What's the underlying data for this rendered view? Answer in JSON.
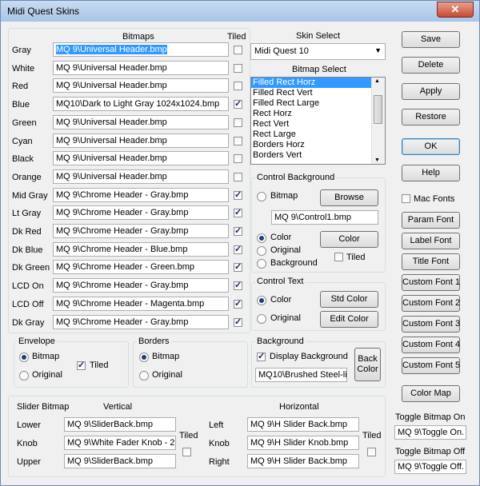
{
  "window": {
    "title": "Midi Quest Skins",
    "close_glyph": "✕"
  },
  "bitmaps": {
    "header": "Bitmaps",
    "tiled_header": "Tiled",
    "rows": [
      {
        "label": "Gray",
        "value": "MQ 9\\Universal Header.bmp",
        "tiled": false,
        "selected": true
      },
      {
        "label": "White",
        "value": "MQ 9\\Universal Header.bmp",
        "tiled": false
      },
      {
        "label": "Red",
        "value": "MQ 9\\Universal Header.bmp",
        "tiled": false
      },
      {
        "label": "Blue",
        "value": "MQ10\\Dark to Light Gray 1024x1024.bmp",
        "tiled": true
      },
      {
        "label": "Green",
        "value": "MQ 9\\Universal Header.bmp",
        "tiled": false
      },
      {
        "label": "Cyan",
        "value": "MQ 9\\Universal Header.bmp",
        "tiled": false
      },
      {
        "label": "Black",
        "value": "MQ 9\\Universal Header.bmp",
        "tiled": false
      },
      {
        "label": "Orange",
        "value": "MQ 9\\Universal Header.bmp",
        "tiled": false
      },
      {
        "label": "Mid Gray",
        "value": "MQ 9\\Chrome Header - Gray.bmp",
        "tiled": true
      },
      {
        "label": "Lt Gray",
        "value": "MQ 9\\Chrome Header - Gray.bmp",
        "tiled": true
      },
      {
        "label": "Dk Red",
        "value": "MQ 9\\Chrome Header - Gray.bmp",
        "tiled": true
      },
      {
        "label": "Dk Blue",
        "value": "MQ 9\\Chrome Header - Blue.bmp",
        "tiled": true
      },
      {
        "label": "Dk Green",
        "value": "MQ 9\\Chrome Header - Green.bmp",
        "tiled": true
      },
      {
        "label": "LCD On",
        "value": "MQ 9\\Chrome Header - Gray.bmp",
        "tiled": true
      },
      {
        "label": "LCD Off",
        "value": "MQ 9\\Chrome Header - Magenta.bmp",
        "tiled": true
      },
      {
        "label": "Dk Gray",
        "value": "MQ 9\\Chrome Header - Gray.bmp",
        "tiled": true
      }
    ]
  },
  "skin_select": {
    "label": "Skin Select",
    "value": "Midi Quest 10"
  },
  "bitmap_select": {
    "label": "Bitmap Select",
    "items": [
      "Filled Rect Horz",
      "Filled Rect Vert",
      "Filled Rect Large",
      "Rect Horz",
      "Rect Vert",
      "Rect Large",
      "Borders Horz",
      "Borders Vert"
    ],
    "selected_index": 0
  },
  "control_background": {
    "title": "Control Background",
    "bitmap_label": "Bitmap",
    "browse_label": "Browse",
    "file": "MQ 9\\Control1.bmp",
    "color_label": "Color",
    "color_button": "Color",
    "original_label": "Original",
    "background_label": "Background",
    "tiled_label": "Tiled",
    "selected": "color",
    "tiled": false
  },
  "control_text": {
    "title": "Control Text",
    "color_label": "Color",
    "original_label": "Original",
    "std_color": "Std Color",
    "edit_color": "Edit Color",
    "selected": "color"
  },
  "envelope": {
    "title": "Envelope",
    "bitmap_label": "Bitmap",
    "original_label": "Original",
    "tiled_label": "Tiled",
    "selected": "bitmap",
    "tiled": true
  },
  "borders": {
    "title": "Borders",
    "bitmap_label": "Bitmap",
    "original_label": "Original",
    "selected": "bitmap"
  },
  "background": {
    "title": "Background",
    "display_label": "Display Background",
    "display": true,
    "file": "MQ10\\Brushed Steel-li",
    "back_color_1": "Back",
    "back_color_2": "Color"
  },
  "slider": {
    "title": "Slider Bitmap",
    "vertical": "Vertical",
    "horizontal": "Horizontal",
    "tiled_label": "Tiled",
    "v_rows": [
      {
        "label": "Lower",
        "value": "MQ 9\\SliderBack.bmp"
      },
      {
        "label": "Knob",
        "value": "MQ 9\\White Fader Knob - 20"
      },
      {
        "label": "Upper",
        "value": "MQ 9\\SliderBack.bmp"
      }
    ],
    "h_rows": [
      {
        "label": "Left",
        "value": "MQ 9\\H Slider Back.bmp"
      },
      {
        "label": "Knob",
        "value": "MQ 9\\H Slider Knob.bmp"
      },
      {
        "label": "Right",
        "value": "MQ 9\\H Slider Back.bmp"
      }
    ],
    "v_tiled": false,
    "h_tiled": false
  },
  "right_panel": {
    "save": "Save",
    "delete": "Delete",
    "apply": "Apply",
    "restore": "Restore",
    "ok": "OK",
    "help": "Help",
    "mac_fonts": "Mac Fonts",
    "mac_fonts_checked": false,
    "param_font": "Param Font",
    "label_font": "Label Font",
    "title_font": "Title Font",
    "custom_fonts": [
      "Custom Font 1",
      "Custom Font 2",
      "Custom Font 3",
      "Custom Font 4",
      "Custom Font 5"
    ],
    "color_map": "Color Map",
    "toggle_on_label": "Toggle Bitmap On",
    "toggle_on_value": "MQ 9\\Toggle On.",
    "toggle_off_label": "Toggle Bitmap Off",
    "toggle_off_value": "MQ 9\\Toggle Off."
  },
  "colors": {
    "accent": "#3399ff",
    "title_bar": "#b9d1ea",
    "close": "#c64a35"
  }
}
